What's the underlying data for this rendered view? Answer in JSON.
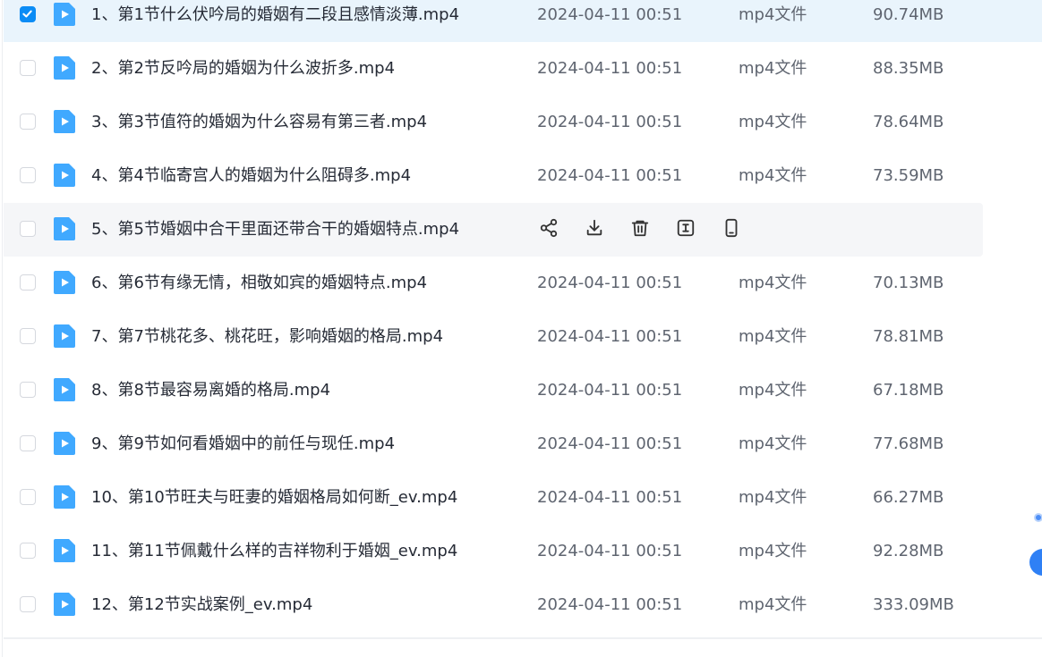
{
  "colors": {
    "accent": "#0b8cf5",
    "selected_row_bg": "#e9f4fc",
    "hover_row_bg": "#f5f6f8",
    "file_icon": "#40a9ff",
    "text_primary": "#262b36",
    "text_secondary": "#5f6570"
  },
  "hover_actions": [
    {
      "icon": "share-icon"
    },
    {
      "icon": "download-icon"
    },
    {
      "icon": "delete-icon"
    },
    {
      "icon": "rename-icon"
    },
    {
      "icon": "mobile-icon"
    }
  ],
  "files": [
    {
      "name": "1、第1节什么伏吟局的婚姻有二段且感情淡薄.mp4",
      "date": "2024-04-11 00:51",
      "type": "mp4文件",
      "size": "90.74MB",
      "checked": true
    },
    {
      "name": "2、第2节反吟局的婚姻为什么波折多.mp4",
      "date": "2024-04-11 00:51",
      "type": "mp4文件",
      "size": "88.35MB",
      "checked": false
    },
    {
      "name": "3、第3节值符的婚姻为什么容易有第三者.mp4",
      "date": "2024-04-11 00:51",
      "type": "mp4文件",
      "size": "78.64MB",
      "checked": false
    },
    {
      "name": "4、第4节临寄宫人的婚姻为什么阻碍多.mp4",
      "date": "2024-04-11 00:51",
      "type": "mp4文件",
      "size": "73.59MB",
      "checked": false
    },
    {
      "name": "5、第5节婚姻中合干里面还带合干的婚姻特点.mp4",
      "date": "",
      "type": "",
      "size": "",
      "checked": false,
      "hovered": true
    },
    {
      "name": "6、第6节有缘无情，相敬如宾的婚姻特点.mp4",
      "date": "2024-04-11 00:51",
      "type": "mp4文件",
      "size": "70.13MB",
      "checked": false
    },
    {
      "name": "7、第7节桃花多、桃花旺，影响婚姻的格局.mp4",
      "date": "2024-04-11 00:51",
      "type": "mp4文件",
      "size": "78.81MB",
      "checked": false
    },
    {
      "name": "8、第8节最容易离婚的格局.mp4",
      "date": "2024-04-11 00:51",
      "type": "mp4文件",
      "size": "67.18MB",
      "checked": false
    },
    {
      "name": "9、第9节如何看婚姻中的前任与现任.mp4",
      "date": "2024-04-11 00:51",
      "type": "mp4文件",
      "size": "77.68MB",
      "checked": false
    },
    {
      "name": "10、第10节旺夫与旺妻的婚姻格局如何断_ev.mp4",
      "date": "2024-04-11 00:51",
      "type": "mp4文件",
      "size": "66.27MB",
      "checked": false
    },
    {
      "name": "11、第11节佩戴什么样的吉祥物利于婚姻_ev.mp4",
      "date": "2024-04-11 00:51",
      "type": "mp4文件",
      "size": "92.28MB",
      "checked": false
    },
    {
      "name": "12、第12节实战案例_ev.mp4",
      "date": "2024-04-11 00:51",
      "type": "mp4文件",
      "size": "333.09MB",
      "checked": false
    }
  ]
}
